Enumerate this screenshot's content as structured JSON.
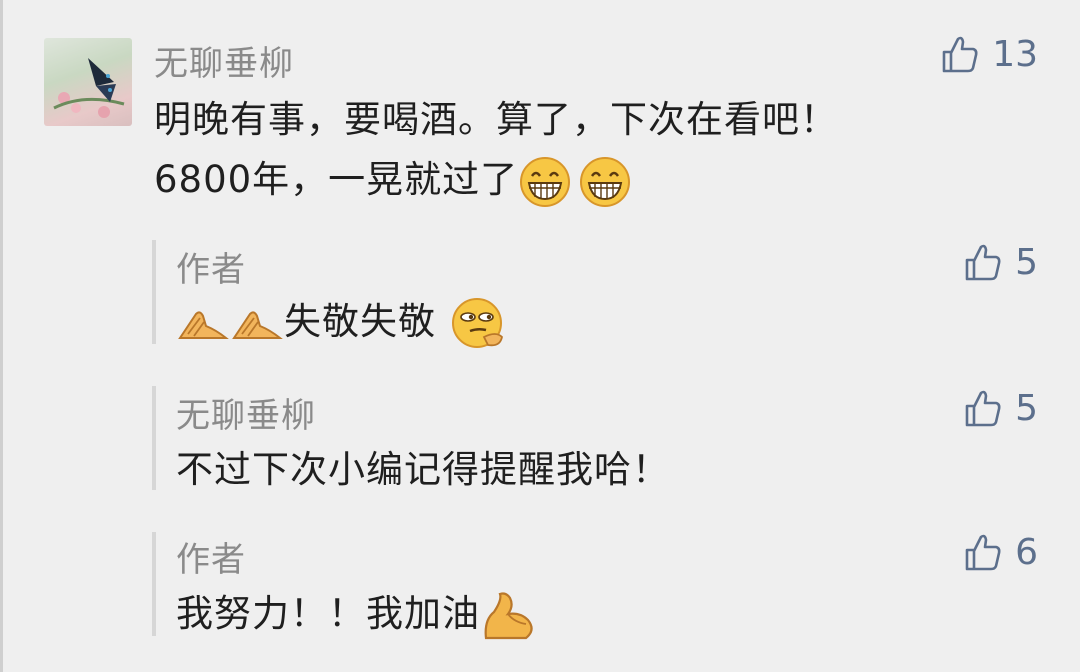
{
  "comments": [
    {
      "author": "无聊垂柳",
      "likes": "13",
      "line1": "明晚有事，要喝酒。算了，下次在看吧！",
      "line2": "6800年，一晃就过了"
    }
  ],
  "replies": [
    {
      "author": "作者",
      "likes": "5",
      "text": "失敬失敬"
    },
    {
      "author": "无聊垂柳",
      "likes": "5",
      "text": "不过下次小编记得提醒我哈！"
    },
    {
      "author": "作者",
      "likes": "6",
      "text": "我努力！！我加油"
    }
  ],
  "icons": {
    "like": "thumbs-up-icon",
    "grin": "grinning-emoji",
    "hands": "clasped-hands-emoji",
    "smirk": "smirk-thinking-emoji",
    "muscle": "flexed-biceps-emoji"
  },
  "colors": {
    "background": "#efefef",
    "author": "#8a8a8a",
    "text": "#1f1f1f",
    "like": "#5c6f8c"
  }
}
